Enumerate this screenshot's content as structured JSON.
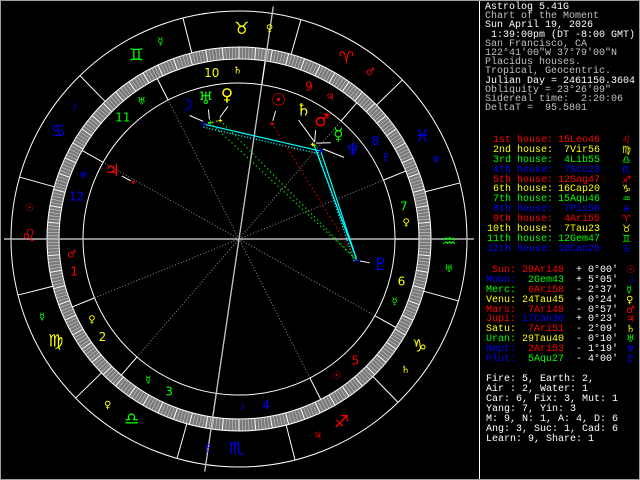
{
  "header": [
    {
      "text": "Astrolog 5.41G",
      "color": "#ffffff"
    },
    {
      "text": "Chart of the Moment",
      "color": "#c0c0c0"
    },
    {
      "text": "Sun April 19, 2026",
      "color": "#ffffff"
    },
    {
      "text": " 1:39:00pm (DT -8:00 GMT)",
      "color": "#ffffff"
    },
    {
      "text": "San Francisco, CA",
      "color": "#c0c0c0"
    },
    {
      "text": "122°41'00\"W 37°79'00\"N",
      "color": "#c0c0c0"
    },
    {
      "text": "Placidus houses.",
      "color": "#c0c0c0"
    },
    {
      "text": "Tropical, Geocentric.",
      "color": "#c0c0c0"
    },
    {
      "text": "Julian Day = 2461150.3604",
      "color": "#ffffff"
    },
    {
      "text": "Obliquity = 23°26'09\"",
      "color": "#c0c0c0"
    },
    {
      "text": "Sidereal time:  2:20:06",
      "color": "#c0c0c0"
    },
    {
      "text": "DeltaT =  95.5801",
      "color": "#c0c0c0"
    }
  ],
  "colors": {
    "fire": "#ff0000",
    "earth": "#ffff00",
    "air": "#00ff00",
    "water": "#0000ff",
    "aspect_sextile": "#00ffff",
    "aspect_square": "#ff0000",
    "aspect_green": "#00ff00",
    "aspect_conj": "#ffff00",
    "axis": "#c0c0c0",
    "cusp_dotted": "#909090"
  },
  "signs": [
    {
      "abbr": "Ari",
      "glyph": "♈",
      "color": "#ff0000",
      "ruler": "♂",
      "ruler_color": "#ff0000"
    },
    {
      "abbr": "Tau",
      "glyph": "♉",
      "color": "#ffff00",
      "ruler": "♀",
      "ruler_color": "#ffff00"
    },
    {
      "abbr": "Gem",
      "glyph": "♊",
      "color": "#00ff00",
      "ruler": "☿",
      "ruler_color": "#00ff00"
    },
    {
      "abbr": "Can",
      "glyph": "♋",
      "color": "#0000ff",
      "ruler": "☽",
      "ruler_color": "#0000ff"
    },
    {
      "abbr": "Leo",
      "glyph": "♌",
      "color": "#ff0000",
      "ruler": "☉",
      "ruler_color": "#ff0000"
    },
    {
      "abbr": "Vir",
      "glyph": "♍",
      "color": "#ffff00",
      "ruler": "☿",
      "ruler_color": "#00ff00"
    },
    {
      "abbr": "Lib",
      "glyph": "♎",
      "color": "#00ff00",
      "ruler": "♀",
      "ruler_color": "#ffff00"
    },
    {
      "abbr": "Sco",
      "glyph": "♏",
      "color": "#0000ff",
      "ruler": "♇",
      "ruler_color": "#0000ff"
    },
    {
      "abbr": "Sag",
      "glyph": "♐",
      "color": "#ff0000",
      "ruler": "♃",
      "ruler_color": "#ff0000"
    },
    {
      "abbr": "Cap",
      "glyph": "♑",
      "color": "#ffff00",
      "ruler": "♄",
      "ruler_color": "#ffff00"
    },
    {
      "abbr": "Aqu",
      "glyph": "♒",
      "color": "#00ff00",
      "ruler": "♅",
      "ruler_color": "#00ff00"
    },
    {
      "abbr": "Pis",
      "glyph": "♓",
      "color": "#0000ff",
      "ruler": "♆",
      "ruler_color": "#0000ff"
    }
  ],
  "houses": [
    {
      "label": "1st house:",
      "value": "15Leo46",
      "glyph": "♌",
      "color": "#ff0000",
      "number": "1"
    },
    {
      "label": "2nd house:",
      "value": "7Vir56",
      "glyph": "♍",
      "color": "#ffff00",
      "number": "2"
    },
    {
      "label": "3rd house:",
      "value": "4Lib55",
      "glyph": "♎",
      "color": "#00ff00",
      "number": "3"
    },
    {
      "label": "4th house:",
      "value": "7Sco23",
      "glyph": "♏",
      "color": "#0000ff",
      "number": "4"
    },
    {
      "label": "5th house:",
      "value": "12Sag47",
      "glyph": "♐",
      "color": "#ff0000",
      "number": "5"
    },
    {
      "label": "6th house:",
      "value": "16Cap20",
      "glyph": "♑",
      "color": "#ffff00",
      "number": "6"
    },
    {
      "label": "7th house:",
      "value": "15Aqu46",
      "glyph": "♒",
      "color": "#00ff00",
      "number": "7"
    },
    {
      "label": "8th house:",
      "value": "7Pis56",
      "glyph": "♓",
      "color": "#0000ff",
      "number": "8"
    },
    {
      "label": "9th house:",
      "value": "4Ari55",
      "glyph": "♈",
      "color": "#ff0000",
      "number": "9"
    },
    {
      "label": "10th house:",
      "value": "7Tau23",
      "glyph": "♉",
      "color": "#ffff00",
      "number": "10"
    },
    {
      "label": "11th house:",
      "value": "12Gem47",
      "glyph": "♊",
      "color": "#00ff00",
      "number": "11"
    },
    {
      "label": "12th house:",
      "value": "16Can20",
      "glyph": "♋",
      "color": "#0000ff",
      "number": "12"
    }
  ],
  "planets": [
    {
      "key": "sun",
      "label": "Sun:",
      "value": "29Ari48",
      "value_color": "#ff0000",
      "lat": "+ 0°00'",
      "glyph": "☉",
      "color": "#ff0000"
    },
    {
      "key": "moon",
      "label": "Moon:",
      "value": "2Gem43",
      "value_color": "#00ff00",
      "lat": "+ 5°05'",
      "glyph": "☽",
      "color": "#0000ff"
    },
    {
      "key": "mercury",
      "label": "Merc:",
      "value": "6Ari58",
      "value_color": "#ff0000",
      "lat": "- 2°37'",
      "glyph": "☿",
      "color": "#00ff00"
    },
    {
      "key": "venus",
      "label": "Venu:",
      "value": "24Tau45",
      "value_color": "#ffff00",
      "lat": "+ 0°24'",
      "glyph": "♀",
      "color": "#ffff00"
    },
    {
      "key": "mars",
      "label": "Mars:",
      "value": "7Ari48",
      "value_color": "#ff0000",
      "lat": "- 0°57'",
      "glyph": "♂",
      "color": "#ff0000"
    },
    {
      "key": "jupiter",
      "label": "Jupi:",
      "value": "17Can30",
      "value_color": "#0000ff",
      "lat": "+ 0°23'",
      "glyph": "♃",
      "color": "#ff0000"
    },
    {
      "key": "saturn",
      "label": "Satu:",
      "value": "7Ari51",
      "value_color": "#ff0000",
      "lat": "- 2°09'",
      "glyph": "♄",
      "color": "#ffff00"
    },
    {
      "key": "uranus",
      "label": "Uran:",
      "value": "29Tau40",
      "value_color": "#ffff00",
      "lat": "- 0°10'",
      "glyph": "♅",
      "color": "#00ff00"
    },
    {
      "key": "neptune",
      "label": "Nept:",
      "value": "2Ari53",
      "value_color": "#ff0000",
      "lat": "- 1°19'",
      "glyph": "♆",
      "color": "#0000ff"
    },
    {
      "key": "pluto",
      "label": "Plut:",
      "value": "5Aqu27",
      "value_color": "#00ff00",
      "lat": "- 4°00'",
      "glyph": "♇",
      "color": "#0000ff"
    }
  ],
  "aspects": [
    {
      "from": "moon",
      "to": "neptune",
      "color": "#00ffff",
      "style": "double"
    },
    {
      "from": "neptune",
      "to": "pluto",
      "color": "#00ffff",
      "style": "double"
    },
    {
      "from": "mercury",
      "to": "pluto",
      "color": "#00ffff",
      "style": "solid"
    },
    {
      "from": "sun",
      "to": "pluto",
      "color": "#ff0000",
      "style": "dotted"
    },
    {
      "from": "uranus",
      "to": "pluto",
      "color": "#00ff00",
      "style": "dotted"
    },
    {
      "from": "venus",
      "to": "pluto",
      "color": "#00ff00",
      "style": "dotted"
    },
    {
      "from": "moon",
      "to": "venus",
      "color": "#ffff00",
      "style": "dotted"
    }
  ],
  "stats": [
    "Fire: 5, Earth: 2,",
    "Air : 2, Water: 1",
    "Car: 6, Fix: 3, Mut: 1",
    "Yang: 7, Yin: 3",
    "M: 9, N: 1, A: 4, D: 6",
    "Ang: 3, Suc: 1, Cad: 6",
    "Learn: 9, Share: 1"
  ]
}
